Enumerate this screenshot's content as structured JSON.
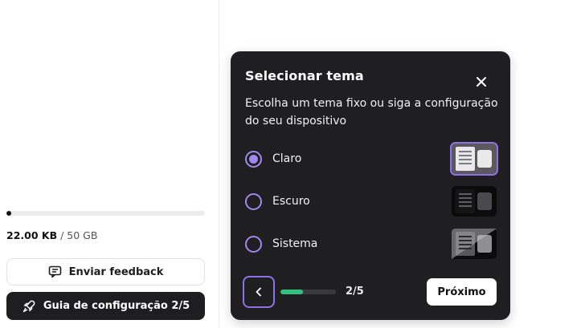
{
  "sidebar": {
    "storage": {
      "used": "22.00 KB",
      "total": "/ 50 GB",
      "fraction": 4e-07
    },
    "feedback_label": "Enviar feedback",
    "guide_label": "Guia de configuração 2/5"
  },
  "dialog": {
    "title": "Selecionar tema",
    "description": "Escolha um tema fixo ou siga a configuração do seu dispositivo",
    "options": [
      {
        "label": "Claro",
        "selected": true,
        "thumb": "light-theme-thumbnail"
      },
      {
        "label": "Escuro",
        "selected": false,
        "thumb": "dark-theme-thumbnail"
      },
      {
        "label": "Sistema",
        "selected": false,
        "thumb": "system-theme-thumbnail"
      }
    ],
    "progress": {
      "current": 2,
      "total": 5
    },
    "step_text": "2/5",
    "next_label": "Próximo"
  },
  "icons": {
    "feedback": "message-square-icon",
    "guide": "rocket-icon",
    "close": "close-icon",
    "back": "chevron-left-icon"
  },
  "colors": {
    "dialog_bg": "#1f1f21",
    "accent": "#9f88f0",
    "progress": "#2ec27e",
    "guide_button_bg": "#1e1e20"
  }
}
